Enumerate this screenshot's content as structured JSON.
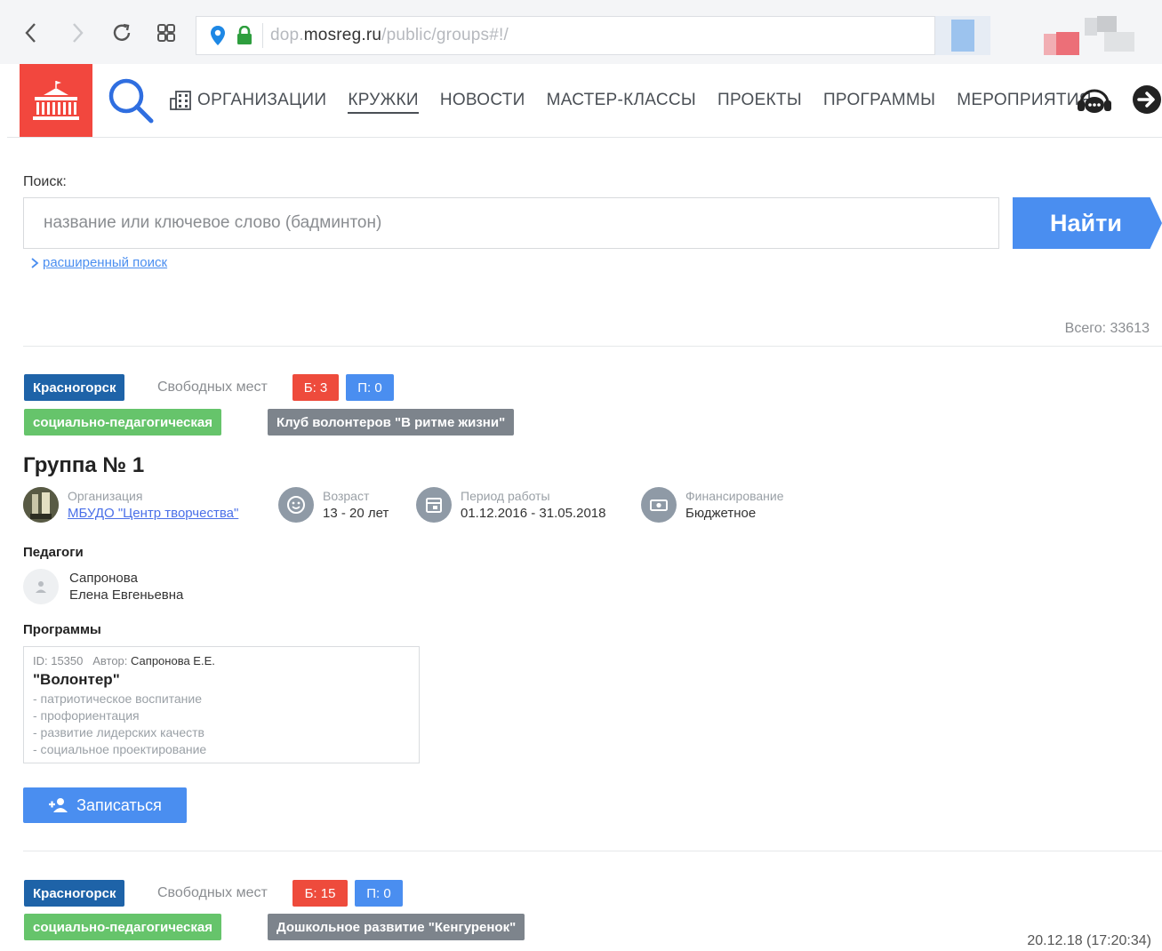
{
  "browser": {
    "url_prefix": "dop.",
    "url_domain": "mosreg.ru",
    "url_path": "/public/groups#!/"
  },
  "header": {
    "menu": [
      "ОРГАНИЗАЦИИ",
      "КРУЖКИ",
      "НОВОСТИ",
      "МАСТЕР-КЛАССЫ",
      "ПРОЕКТЫ",
      "ПРОГРАММЫ",
      "МЕРОПРИЯТИЯ"
    ],
    "active_item": "КРУЖКИ"
  },
  "search": {
    "label": "Поиск:",
    "placeholder": "название или ключевое слово (бадминтон)",
    "button": "Найти",
    "advanced": "расширенный поиск"
  },
  "total": "Всего: 33613",
  "groups": [
    {
      "city": "Красногорск",
      "free_label": "Свободных мест",
      "free_b": "Б: 3",
      "free_p": "П: 0",
      "direction": "социально-педагогическая",
      "club": "Клуб волонтеров \"В ритме жизни\"",
      "title": "Группа № 1",
      "org_label": "Организация",
      "org_value": "МБУДО \"Центр творчества\"",
      "age_label": "Возраст",
      "age_value": "13 - 20 лет",
      "period_label": "Период работы",
      "period_value": "01.12.2016 - 31.05.2018",
      "finance_label": "Финансирование",
      "finance_value": "Бюджетное",
      "teachers_label": "Педагоги",
      "teacher_last": "Сапронова",
      "teacher_first": "Елена Евгеньевна",
      "programs_label": "Программы",
      "program": {
        "id": "ID: 15350",
        "author_label": "Автор:",
        "author": "Сапронова Е.Е.",
        "title": "\"Волонтер\"",
        "items": [
          "- патриотическое воспитание",
          "- профориентация",
          "- развитие лидерских качеств",
          "- социальное проектирование"
        ]
      },
      "enroll": "Записаться"
    },
    {
      "city": "Красногорск",
      "free_label": "Свободных мест",
      "free_b": "Б: 15",
      "free_p": "П: 0",
      "direction": "социально-педагогическая",
      "club": "Дошкольное развитие \"Кенгуренок\""
    }
  ],
  "timestamp": "20.12.18 (17:20:34)",
  "colors": {
    "logo": "#f2473e",
    "primary_blue": "#4a8ef0",
    "city_badge": "#1e63a8",
    "red_badge": "#ee4b3c",
    "green_badge": "#66c46b",
    "gray_badge": "#7d848c"
  }
}
